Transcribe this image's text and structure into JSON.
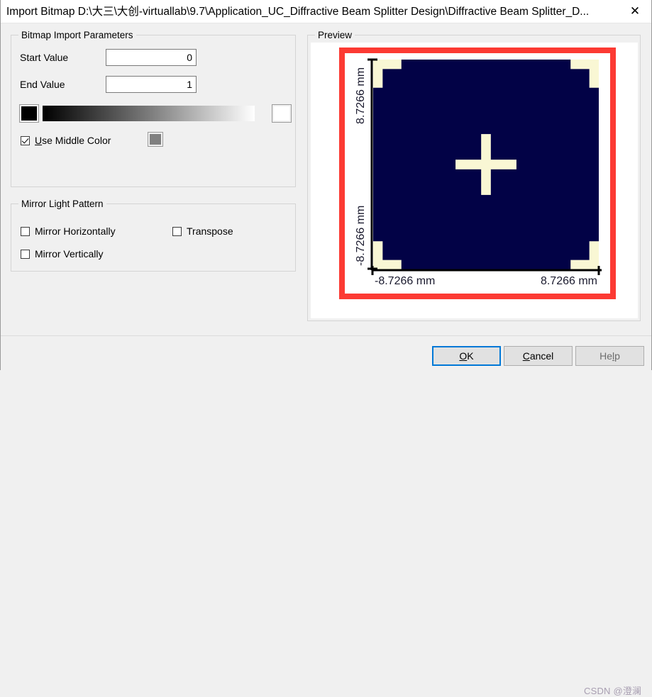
{
  "window": {
    "title": "Import Bitmap D:\\大三\\大创-virtuallab\\9.7\\Application_UC_Diffractive Beam Splitter Design\\Diffractive Beam Splitter_D...",
    "close_label": "✕"
  },
  "bitmap_group": {
    "title": "Bitmap Import Parameters",
    "start_value_label": "Start Value",
    "start_value": "0",
    "end_value_label": "End Value",
    "end_value": "1",
    "start_color": "#000000",
    "end_color": "#ffffff",
    "middle_color": "#808080",
    "use_middle_color_label": "Use Middle Color",
    "use_middle_color_checked": true
  },
  "mirror_group": {
    "title": "Mirror Light Pattern",
    "mirror_horizontally_label": "Mirror Horizontally",
    "mirror_horizontally_checked": false,
    "mirror_vertically_label": "Mirror Vertically",
    "mirror_vertically_checked": false,
    "transpose_label": "Transpose",
    "transpose_checked": false
  },
  "preview_group": {
    "title": "Preview",
    "preview_button_label": "Preview",
    "frame_color": "#fc3a33"
  },
  "chart_data": {
    "type": "heatmap",
    "title": "",
    "xlabel": "",
    "ylabel": "",
    "x_tick_labels": [
      "-8.7266 mm",
      "8.7266 mm"
    ],
    "y_tick_labels": [
      "8.7266 mm",
      "-8.7266 mm"
    ],
    "xlim": [
      -8.7266,
      8.7266
    ],
    "ylim": [
      -8.7266,
      8.7266
    ],
    "units": "mm",
    "background_color": "#020246",
    "pattern_color": "#f9f7d4",
    "grid": false,
    "legend": "none",
    "description": "Binary diffractive beam splitter light pattern: dark navy field with cream L-shaped alignment marks in all four corners and a cream plus/cross mark at the centre.",
    "features": [
      {
        "name": "corner-mark-top-left",
        "x": -8.7266,
        "y": 8.7266
      },
      {
        "name": "corner-mark-top-right",
        "x": 8.7266,
        "y": 8.7266
      },
      {
        "name": "corner-mark-bottom-left",
        "x": -8.7266,
        "y": -8.7266
      },
      {
        "name": "corner-mark-bottom-right",
        "x": 8.7266,
        "y": -8.7266
      },
      {
        "name": "center-cross",
        "x": 0,
        "y": 0
      }
    ]
  },
  "footer": {
    "ok_label": "OK",
    "cancel_label": "Cancel",
    "help_label": "Help"
  },
  "watermark": {
    "text": "CSDN @澄澜"
  }
}
